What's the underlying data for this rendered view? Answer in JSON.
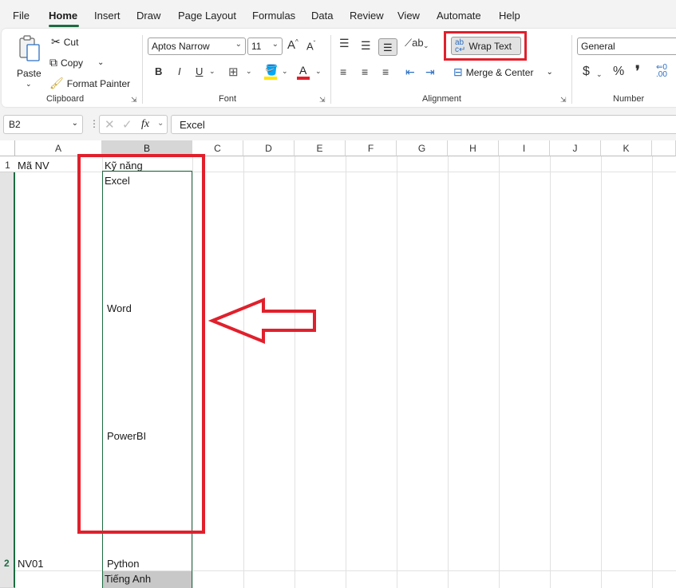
{
  "menu": {
    "tabs": [
      "File",
      "Home",
      "Insert",
      "Draw",
      "Page Layout",
      "Formulas",
      "Data",
      "Review",
      "View",
      "Automate",
      "Help"
    ]
  },
  "ribbon": {
    "clipboard": {
      "paste": "Paste",
      "cut": "Cut",
      "copy": "Copy",
      "format_painter": "Format Painter",
      "label": "Clipboard"
    },
    "font": {
      "font_name": "Aptos Narrow",
      "font_size": "11",
      "bold": "B",
      "italic": "I",
      "underline": "U",
      "font_color_letter": "A",
      "label": "Font"
    },
    "alignment": {
      "wrap_text": "Wrap Text",
      "merge_center": "Merge & Center",
      "label": "Alignment"
    },
    "number": {
      "format": "General",
      "currency": "$",
      "percent": "%",
      "comma": "❜",
      "label": "Number"
    }
  },
  "formula_bar": {
    "name_box": "B2",
    "fx": "fx",
    "formula": "Excel"
  },
  "sheet": {
    "columns": [
      "A",
      "B",
      "C",
      "D",
      "E",
      "F",
      "G",
      "H",
      "I",
      "J",
      "K"
    ],
    "rows": [
      "1",
      "2"
    ],
    "cells": {
      "A1": "Mã NV",
      "B1": "Kỹ năng",
      "B2_line1": "Excel",
      "B2_line2": "Word",
      "B2_line3": "PowerBI",
      "A2": "NV01",
      "B2_line4": "Python",
      "B3": "Tiếng Anh"
    }
  },
  "colors": {
    "accent": "#1e6c41",
    "highlight": "#e0202c"
  }
}
